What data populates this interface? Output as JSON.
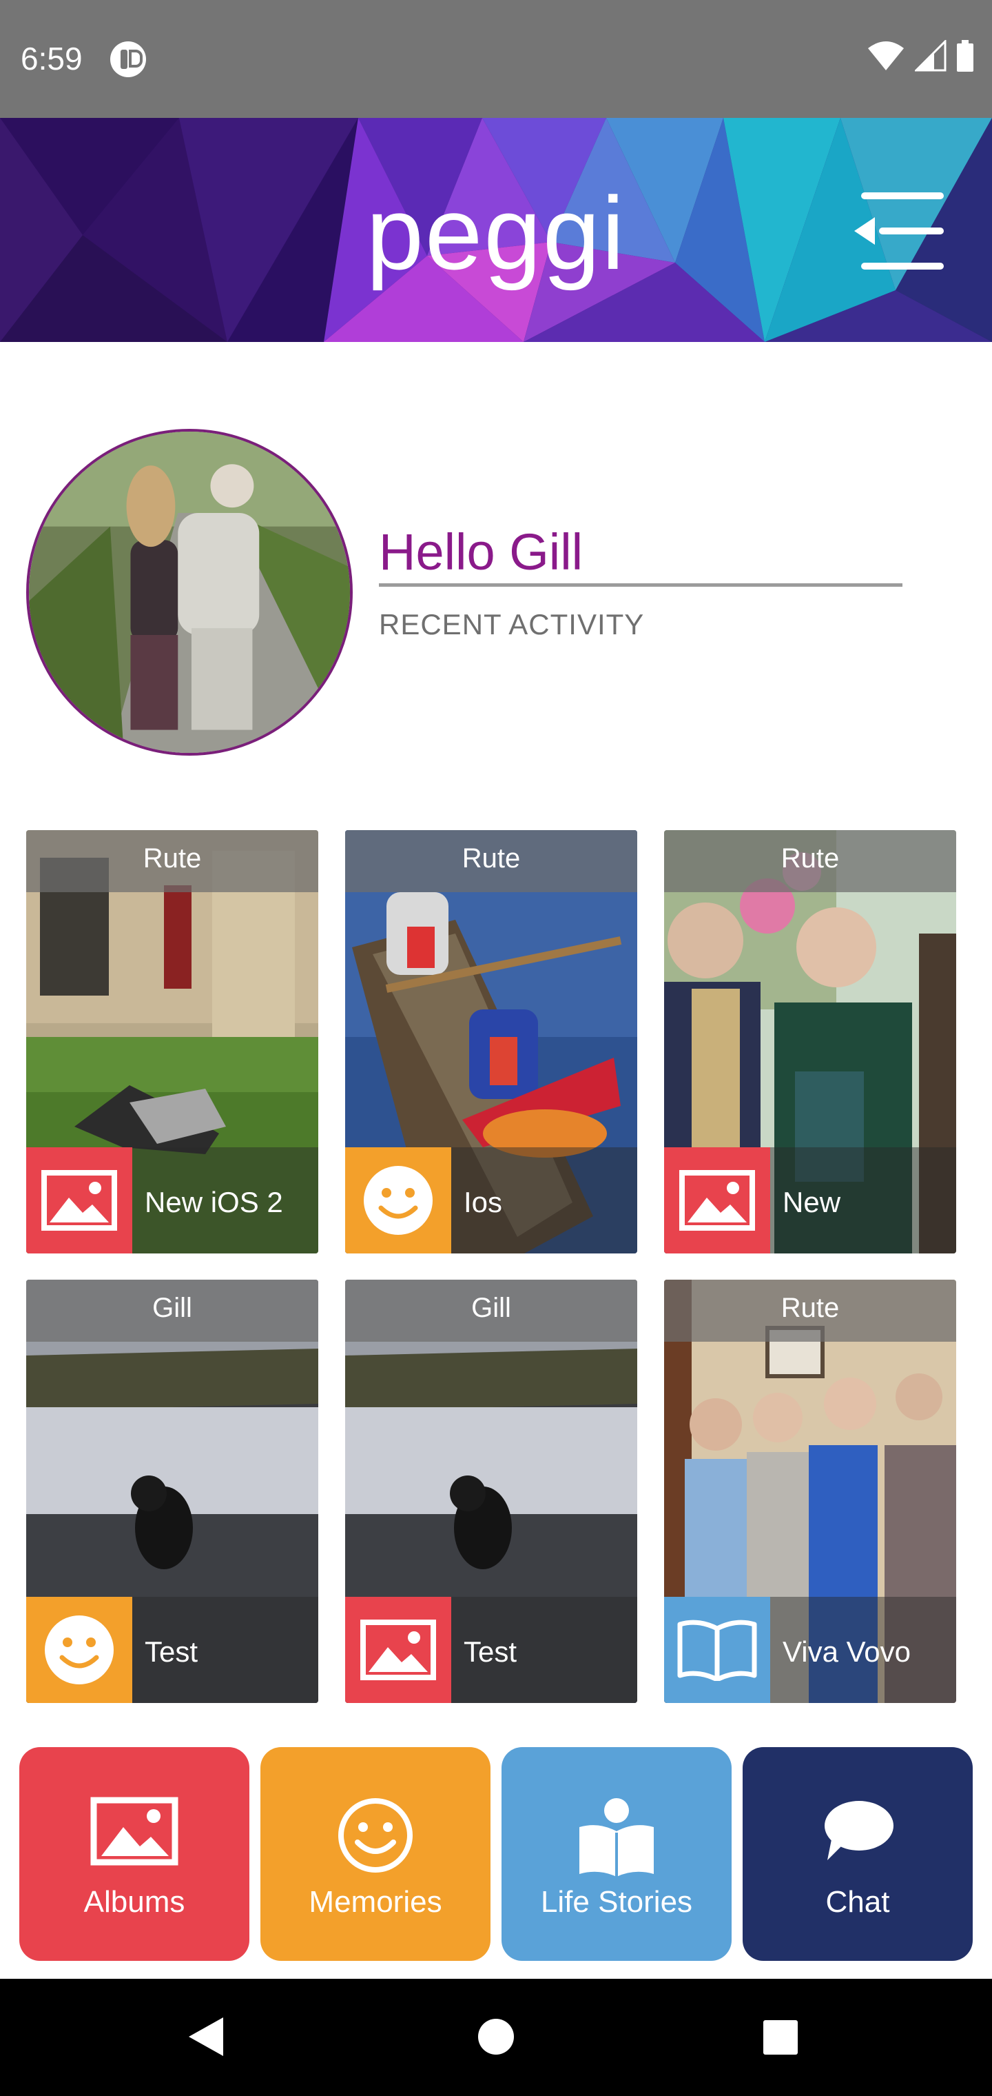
{
  "status_bar": {
    "time": "6:59",
    "icons": [
      "app-notification-icon",
      "wifi-icon",
      "cell-signal-icon",
      "battery-icon"
    ]
  },
  "header": {
    "brand": "peggi",
    "menu_icon": "menu-collapse-icon"
  },
  "profile": {
    "greeting": "Hello Gill",
    "subtitle": "RECENT ACTIVITY"
  },
  "activity": [
    {
      "owner": "Rute",
      "caption": "New iOS 2",
      "type": "album",
      "badge_color": "#e8434d"
    },
    {
      "owner": "Rute",
      "caption": "Ios",
      "type": "memory",
      "badge_color": "#f3a02b"
    },
    {
      "owner": "Rute",
      "caption": "New",
      "type": "album",
      "badge_color": "#e8434d"
    },
    {
      "owner": "Gill",
      "caption": "Test",
      "type": "memory",
      "badge_color": "#f3a02b"
    },
    {
      "owner": "Gill",
      "caption": "Test",
      "type": "album",
      "badge_color": "#e8434d"
    },
    {
      "owner": "Rute",
      "caption": "Viva Vovo",
      "type": "life-story",
      "badge_color": "#5aa2d8"
    }
  ],
  "nav": {
    "albums": "Albums",
    "memories": "Memories",
    "life_stories": "Life Stories",
    "chat": "Chat"
  },
  "colors": {
    "accent_purple": "#8a1a8a",
    "albums": "#e8434d",
    "memories": "#f3a02b",
    "life_stories": "#5aa2d8",
    "chat": "#213067"
  }
}
